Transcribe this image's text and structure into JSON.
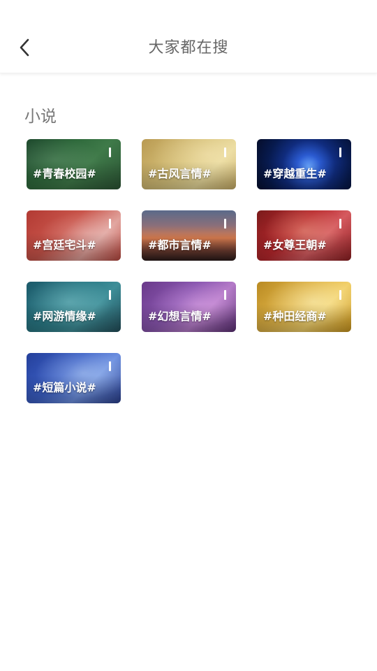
{
  "header": {
    "title": "大家都在搜",
    "back_icon": "chevron-left-icon"
  },
  "section": {
    "title": "小说"
  },
  "cards": [
    {
      "label": "#青春校园#"
    },
    {
      "label": "#古风言情#"
    },
    {
      "label": "#穿越重生#"
    },
    {
      "label": "#宫廷宅斗#"
    },
    {
      "label": "#都市言情#"
    },
    {
      "label": "#女尊王朝#"
    },
    {
      "label": "#网游情缘#"
    },
    {
      "label": "#幻想言情#"
    },
    {
      "label": "#种田经商#"
    },
    {
      "label": "#短篇小说#"
    }
  ],
  "colors": {
    "title_text": "#666666",
    "section_text": "#777777",
    "background": "#ffffff",
    "card_text": "#ffffff"
  }
}
